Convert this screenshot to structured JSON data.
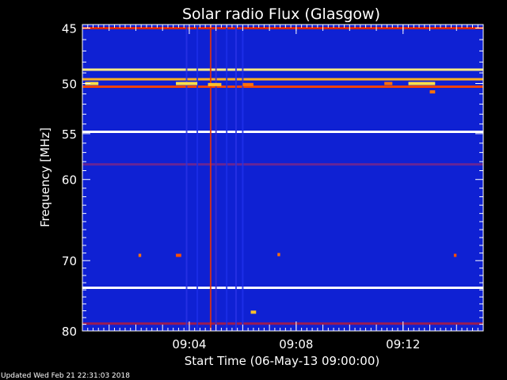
{
  "chart_data": {
    "type": "heatmap",
    "title": "Solar radio Flux (Glasgow)",
    "xlabel": "Start Time (06-May-13 09:00:00)",
    "ylabel": "Frequency [MHz]",
    "x_unit": "minutes after 09:00:00",
    "xlim": [
      0,
      15
    ],
    "x_ticks": [
      {
        "value": 4,
        "label": "09:04"
      },
      {
        "value": 8,
        "label": "09:08"
      },
      {
        "value": 12,
        "label": "09:12"
      }
    ],
    "y_scale": "log",
    "ylim": [
      80,
      44.7
    ],
    "y_ticks": [
      {
        "value": 45,
        "label": "45"
      },
      {
        "value": 50,
        "label": "50"
      },
      {
        "value": 55,
        "label": "55"
      },
      {
        "value": 60,
        "label": "60"
      },
      {
        "value": 70,
        "label": "70"
      },
      {
        "value": 80,
        "label": "80"
      }
    ],
    "colormap": [
      "#00008c",
      "#0a1ccc",
      "#2233ee",
      "#cc1111",
      "#ff5500",
      "#ffdd33",
      "#ffffff"
    ],
    "background_level": 0.2,
    "horizontal_bands": [
      {
        "freq": 45.0,
        "level": 0.55
      },
      {
        "freq": 48.7,
        "level": 0.9
      },
      {
        "freq": 49.6,
        "level": 0.78
      },
      {
        "freq": 50.3,
        "level": 0.62
      },
      {
        "freq": 54.8,
        "level": 1.0
      },
      {
        "freq": 58.3,
        "level": 0.4
      },
      {
        "freq": 73.7,
        "level": 1.0
      },
      {
        "freq": 78.9,
        "level": 0.45
      }
    ],
    "vertical_bands": [
      {
        "time": 3.9,
        "level": 0.34
      },
      {
        "time": 4.3,
        "level": 0.3
      },
      {
        "time": 4.8,
        "level": 0.58
      },
      {
        "time": 5.0,
        "level": 0.36
      },
      {
        "time": 5.4,
        "level": 0.3
      },
      {
        "time": 5.75,
        "level": 0.34
      },
      {
        "time": 6.0,
        "level": 0.32
      }
    ],
    "bursts": [
      {
        "time_start": 0.1,
        "time_end": 0.6,
        "freq": 50.0,
        "level": 0.85
      },
      {
        "time_start": 3.5,
        "time_end": 4.3,
        "freq": 50.0,
        "level": 0.85
      },
      {
        "time_start": 4.7,
        "time_end": 5.2,
        "freq": 50.1,
        "level": 0.8
      },
      {
        "time_start": 6.0,
        "time_end": 6.4,
        "freq": 50.1,
        "level": 0.7
      },
      {
        "time_start": 11.3,
        "time_end": 11.6,
        "freq": 50.0,
        "level": 0.7
      },
      {
        "time_start": 12.2,
        "time_end": 13.2,
        "freq": 50.0,
        "level": 0.85
      },
      {
        "time_start": 13.0,
        "time_end": 13.2,
        "freq": 50.8,
        "level": 0.7
      },
      {
        "time_start": 2.1,
        "time_end": 2.2,
        "freq": 69.3,
        "level": 0.7
      },
      {
        "time_start": 3.5,
        "time_end": 3.7,
        "freq": 69.3,
        "level": 0.65
      },
      {
        "time_start": 7.3,
        "time_end": 7.4,
        "freq": 69.2,
        "level": 0.7
      },
      {
        "time_start": 13.9,
        "time_end": 14.0,
        "freq": 69.3,
        "level": 0.65
      },
      {
        "time_start": 6.3,
        "time_end": 6.5,
        "freq": 77.2,
        "level": 0.8
      }
    ]
  },
  "footer": {
    "updated": "Updated Wed Feb 21 22:31:03 2018"
  }
}
